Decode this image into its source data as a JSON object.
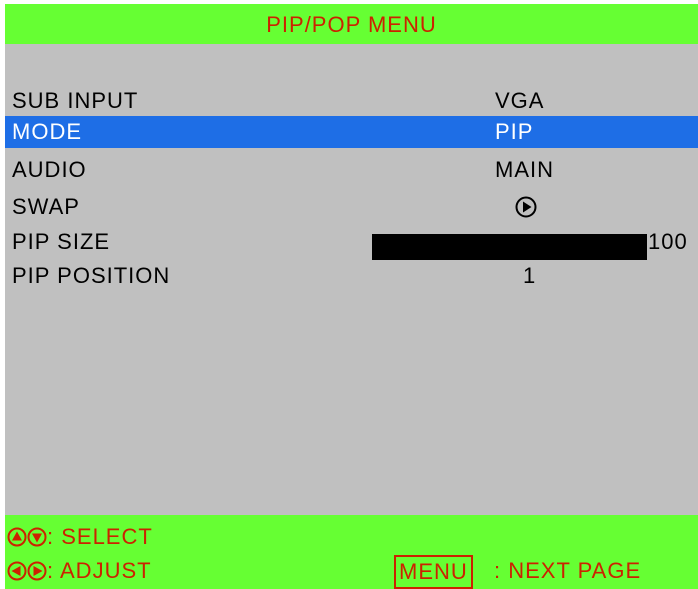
{
  "header": {
    "title": "PIP/POP MENU"
  },
  "menu": {
    "sub_input": {
      "label": "SUB INPUT",
      "value": "VGA"
    },
    "mode": {
      "label": "MODE",
      "value": "PIP"
    },
    "audio": {
      "label": "AUDIO",
      "value": "MAIN"
    },
    "swap": {
      "label": "SWAP",
      "icon": "play-circle-icon"
    },
    "pip_size": {
      "label": "PIP SIZE",
      "value": "100",
      "level_percent": 100
    },
    "pip_position": {
      "label": "PIP POSITION",
      "value": "1"
    }
  },
  "footer": {
    "select_label": ": SELECT",
    "adjust_label": ": ADJUST",
    "menu_key": "MENU",
    "next_page_label": ": NEXT PAGE"
  },
  "colors": {
    "header_bg": "#66ff33",
    "accent_text": "#cc2200",
    "selected_bg": "#1e6ee6",
    "panel_bg": "#c0c0c0"
  }
}
